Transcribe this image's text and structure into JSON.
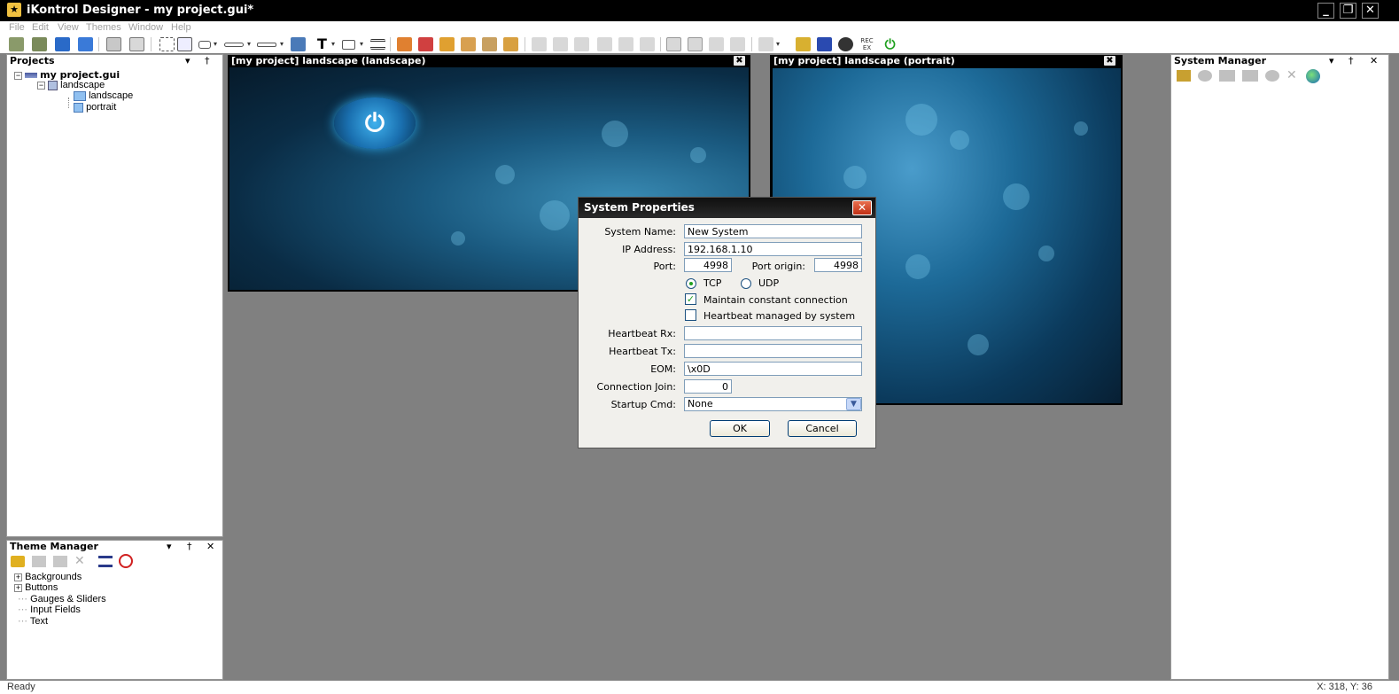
{
  "window": {
    "title": "iKontrol Designer - my project.gui*",
    "controls": {
      "minimize": "_",
      "maximize": "❐",
      "close": "✕"
    }
  },
  "menu": [
    "File",
    "Edit",
    "View",
    "Themes",
    "Window",
    "Help"
  ],
  "toolbar": {
    "text_tool_glyph": "T",
    "icons": [
      "open-project-icon",
      "close-project-icon",
      "save-icon",
      "save-all-icon",
      "page-icon",
      "page-copy-icon",
      "select-area-icon",
      "pointer-add-icon",
      "button-icon",
      "slider-icon",
      "gauge-icon",
      "image-icon",
      "text-tool-icon",
      "input-field-icon",
      "list-icon",
      "theme-tools-icon",
      "align-icon",
      "system-icon",
      "music-icon",
      "settings-icon",
      "rec-icon",
      "power-icon"
    ],
    "rec_label": "REC EX"
  },
  "projects_panel": {
    "title": "Projects",
    "tree": {
      "root": "my project.gui",
      "folder": "landscape",
      "items": [
        "landscape",
        "portrait"
      ]
    }
  },
  "theme_panel": {
    "title": "Theme Manager",
    "items": [
      {
        "label": "Backgrounds",
        "expandable": true
      },
      {
        "label": "Buttons",
        "expandable": true
      },
      {
        "label": "Gauges & Sliders",
        "expandable": false
      },
      {
        "label": "Input Fields",
        "expandable": false
      },
      {
        "label": "Text",
        "expandable": false
      }
    ]
  },
  "system_manager": {
    "title": "System Manager"
  },
  "panel_controls": {
    "dropdown": "▾",
    "pin": "†",
    "close": "✕"
  },
  "documents": {
    "landscape_title": "[my project] landscape (landscape)",
    "portrait_title": "[my project] landscape (portrait)",
    "close_glyph": "✖",
    "power_glyph": "⏻"
  },
  "dialog": {
    "title": "System Properties",
    "close_glyph": "✕",
    "system_name_label": "System Name:",
    "system_name_value": "New System",
    "ip_label": "IP Address:",
    "ip_value": "192.168.1.10",
    "port_label": "Port:",
    "port_value": "4998",
    "port_origin_label": "Port origin:",
    "port_origin_value": "4998",
    "protocol_tcp": "TCP",
    "protocol_udp": "UDP",
    "protocol_selected": "TCP",
    "maintain_label": "Maintain constant connection",
    "maintain_checked": true,
    "heartbeat_managed_label": "Heartbeat managed by system",
    "heartbeat_managed_checked": false,
    "heartbeat_rx_label": "Heartbeat Rx:",
    "heartbeat_rx_value": "",
    "heartbeat_tx_label": "Heartbeat Tx:",
    "heartbeat_tx_value": "",
    "eom_label": "EOM:",
    "eom_value": "\\x0D",
    "connection_join_label": "Connection Join:",
    "connection_join_value": "0",
    "startup_cmd_label": "Startup Cmd:",
    "startup_cmd_value": "None",
    "ok_label": "OK",
    "cancel_label": "Cancel"
  },
  "status": {
    "text": "Ready",
    "coords": "X: 318, Y: 36"
  },
  "colors": {
    "titlebar": "#000000",
    "workspace": "#808080",
    "canvas_dark": "#07253a",
    "canvas_light": "#2f7fa8",
    "dialog_bg": "#f1f0ec",
    "radio_selected": "#21a121"
  }
}
